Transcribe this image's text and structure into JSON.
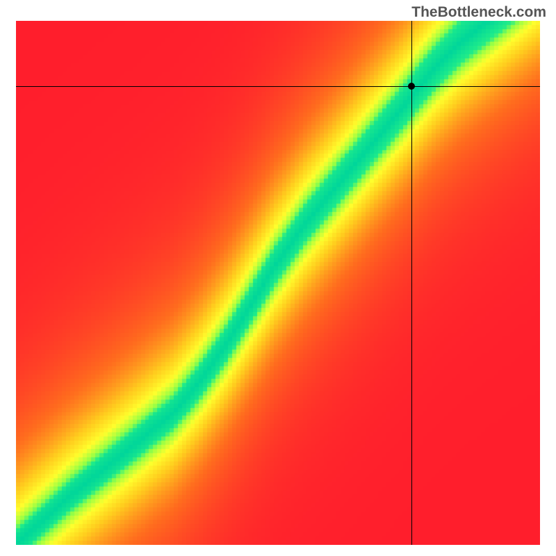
{
  "watermark": "TheBottleneck.com",
  "chart_data": {
    "type": "heatmap",
    "title": "",
    "xlabel": "",
    "ylabel": "",
    "xlim": [
      0,
      100
    ],
    "ylim": [
      0,
      100
    ],
    "colorscale": [
      "#ff1e2d",
      "#ff7a1e",
      "#ffd81e",
      "#ffff2d",
      "#8cff3c",
      "#00e68c",
      "#00d99a"
    ],
    "description": "Bottleneck heatmap. Green diagonal band indicates balanced CPU/GPU pairing; red/orange regions indicate bottleneck. Black crosshair marks the selected component pair.",
    "crosshair": {
      "x": 75.5,
      "y": 87.5
    },
    "optimal_band": [
      {
        "x": 0,
        "y": 0
      },
      {
        "x": 10,
        "y": 9
      },
      {
        "x": 20,
        "y": 17
      },
      {
        "x": 30,
        "y": 25
      },
      {
        "x": 35,
        "y": 31
      },
      {
        "x": 40,
        "y": 38
      },
      {
        "x": 45,
        "y": 46
      },
      {
        "x": 50,
        "y": 54
      },
      {
        "x": 55,
        "y": 61
      },
      {
        "x": 60,
        "y": 67
      },
      {
        "x": 65,
        "y": 73
      },
      {
        "x": 70,
        "y": 79
      },
      {
        "x": 75,
        "y": 85
      },
      {
        "x": 80,
        "y": 91
      },
      {
        "x": 85,
        "y": 96
      },
      {
        "x": 90,
        "y": 100
      }
    ],
    "band_halfwidth_fraction": 0.05
  }
}
